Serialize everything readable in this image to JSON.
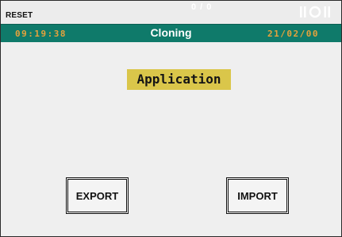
{
  "topbar": {
    "reset_label": "RESET",
    "io_status": "0 / 0",
    "network_icon": "network-status-icon"
  },
  "titlebar": {
    "time": "09:19:38",
    "title": "Cloning",
    "date": "21/02/00"
  },
  "main": {
    "section_label": "Application",
    "export_label": "EXPORT",
    "import_label": "IMPORT"
  },
  "colors": {
    "titlebar_bg": "#0f7a6a",
    "clock_text": "#e6a23c",
    "section_highlight": "#dac64a",
    "screen_bg": "#efefef"
  }
}
